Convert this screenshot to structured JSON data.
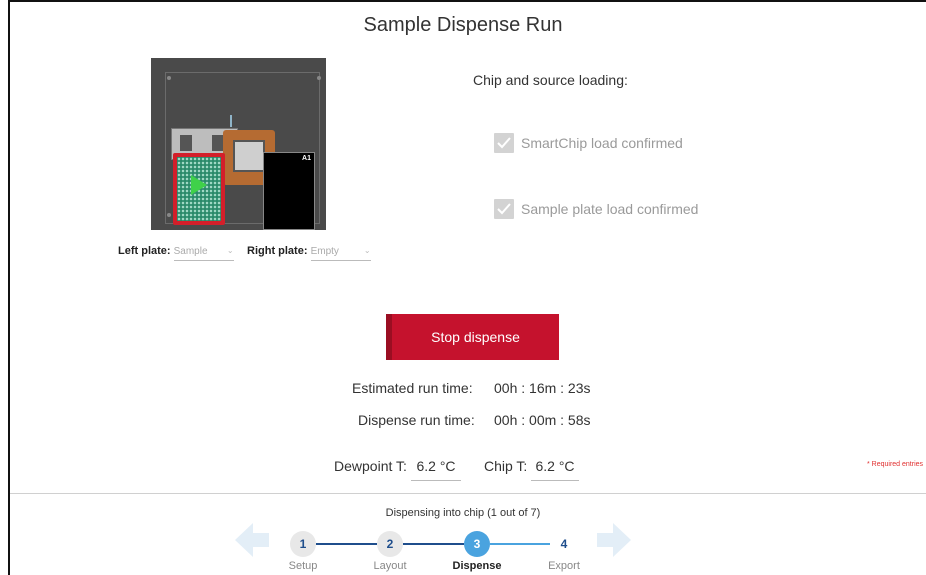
{
  "page": {
    "title": "Sample Dispense Run"
  },
  "deck": {
    "right_plate_corner_label": "A1"
  },
  "plates": {
    "left_label": "Left plate:",
    "left_value": "Sample",
    "right_label": "Right plate:",
    "right_value": "Empty"
  },
  "loading": {
    "title": "Chip and source loading:",
    "smartchip_label": "SmartChip load confirmed",
    "sample_plate_label": "Sample plate load confirmed"
  },
  "actions": {
    "stop_label": "Stop dispense"
  },
  "run": {
    "estimated_label": "Estimated run time:",
    "estimated_value": "00h : 16m : 23s",
    "dispense_label": "Dispense run time:",
    "dispense_value": "00h : 00m : 58s"
  },
  "temps": {
    "dewpoint_label": "Dewpoint T:",
    "dewpoint_value": "6.2 °C",
    "chip_label": "Chip T:",
    "chip_value": "6.2 °C"
  },
  "required_note": "* Required entries",
  "progress": {
    "status": "Dispensing into chip (1 out of 7)",
    "steps": [
      {
        "num": "1",
        "label": "Setup"
      },
      {
        "num": "2",
        "label": "Layout"
      },
      {
        "num": "3",
        "label": "Dispense"
      },
      {
        "num": "4",
        "label": "Export"
      }
    ]
  },
  "colors": {
    "accent": "#c5122d",
    "step_active": "#4aa3df",
    "step_done": "#1f4e8c"
  },
  "icons": {
    "check": "checkmark-icon",
    "prev": "arrow-left-icon",
    "next": "arrow-right-icon",
    "play": "play-icon"
  }
}
